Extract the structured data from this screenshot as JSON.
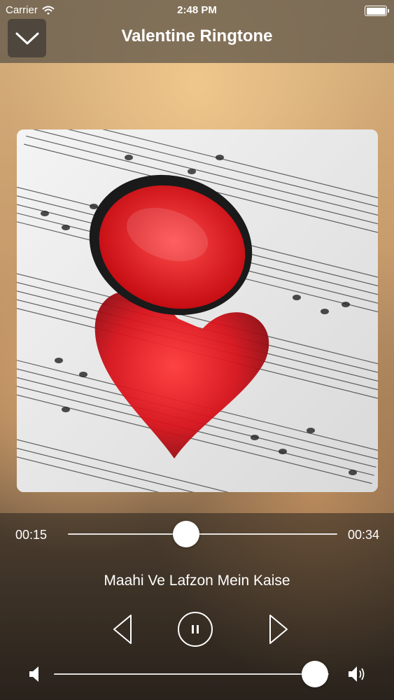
{
  "status_bar": {
    "carrier": "Carrier",
    "time": "2:48 PM"
  },
  "nav": {
    "title": "Valentine Ringtone",
    "dismiss_icon": "chevron-down-icon"
  },
  "artwork": {
    "description_icon": "album-artwork"
  },
  "player": {
    "elapsed": "00:15",
    "total": "00:34",
    "progress_fraction": 0.44,
    "song_title": "Maahi Ve Lafzon Mein Kaise",
    "volume_fraction": 0.95,
    "icons": {
      "prev": "previous-icon",
      "pause": "pause-icon",
      "next": "next-icon",
      "volume_low": "volume-low-icon",
      "volume_high": "volume-high-icon"
    }
  },
  "colors": {
    "accent": "#ffffff",
    "heart": "#d8121b"
  }
}
